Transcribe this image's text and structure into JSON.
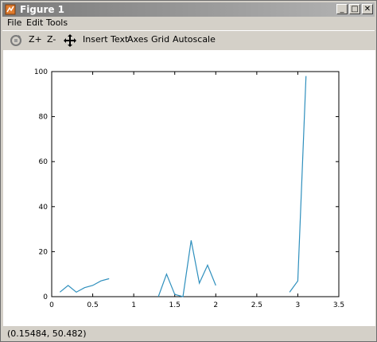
{
  "window": {
    "title": "Figure 1",
    "buttons": {
      "minimize": "_",
      "maximize": "□",
      "close": "✕"
    },
    "titlebar_color": "#8a8a8a"
  },
  "menu": {
    "items": [
      "File",
      "Edit",
      "Tools"
    ]
  },
  "toolbar": {
    "rotate_icon": "rotate-icon",
    "zoom_in": "Z+",
    "zoom_out": "Z-",
    "pan_icon": "pan-arrows-icon",
    "insert_text": "Insert Text",
    "axes": "Axes",
    "grid": "Grid",
    "autoscale": "Autoscale"
  },
  "status": {
    "coordinates": "(0.15484, 50.482)"
  },
  "chart_data": {
    "type": "line",
    "title": "",
    "xlabel": "",
    "ylabel": "",
    "xlim": [
      0,
      3.5
    ],
    "ylim": [
      0,
      100
    ],
    "x_ticks": [
      "0",
      "0.5",
      "1",
      "1.5",
      "2",
      "2.5",
      "3",
      "3.5"
    ],
    "y_ticks": [
      "0",
      "20",
      "40",
      "60",
      "80",
      "100"
    ],
    "line_color": "#2e8fbd",
    "grid": false,
    "segments": [
      {
        "x": [
          0.1,
          0.2,
          0.3,
          0.4,
          0.5,
          0.6,
          0.7
        ],
        "y": [
          2,
          5,
          2,
          4,
          5,
          7,
          8
        ]
      },
      {
        "x": [
          1.3,
          1.4,
          1.5,
          1.6,
          1.7,
          1.8,
          1.9,
          2.0
        ],
        "y": [
          0,
          10,
          1,
          0,
          25,
          6,
          14,
          5
        ]
      },
      {
        "x": [
          2.9,
          3.0,
          3.1
        ],
        "y": [
          2,
          7,
          98
        ]
      }
    ]
  }
}
